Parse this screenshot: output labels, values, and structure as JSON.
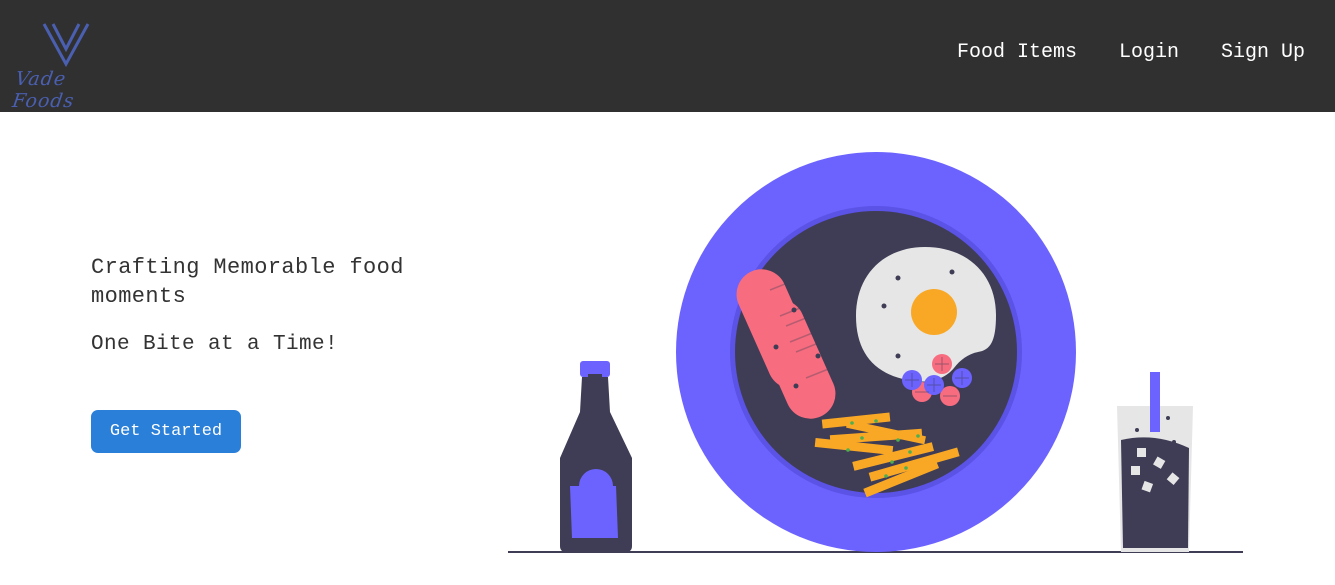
{
  "brand": {
    "logo_text": "Vade Foods",
    "logo_color": "#4a5fb0"
  },
  "nav": {
    "items": [
      {
        "label": "Food Items"
      },
      {
        "label": "Login"
      },
      {
        "label": "Sign Up"
      }
    ],
    "background": "#303030"
  },
  "hero": {
    "headline": "Crafting Memorable food moments",
    "subheadline": "One Bite at a Time!",
    "cta_label": "Get Started",
    "cta_color": "#2a7fd9"
  },
  "illustration": {
    "accent_color": "#6c63ff",
    "dark_color": "#3f3d56",
    "sausage_color": "#f86c7f",
    "fries_color": "#f9a826"
  }
}
